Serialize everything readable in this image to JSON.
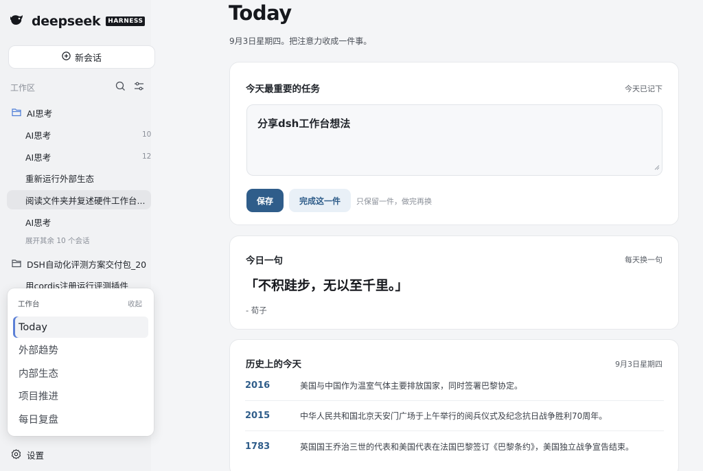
{
  "sidebar": {
    "brand": "deepseek",
    "badge": "HARNESS",
    "new_chat": "新会话",
    "workspace_label": "工作区",
    "folders": [
      {
        "label": "AI思考"
      },
      {
        "label": "DSH自动化评测方案交付包_20"
      }
    ],
    "conversations": [
      {
        "label": "AI思考",
        "count": "10"
      },
      {
        "label": "AI思考",
        "count": "12"
      },
      {
        "label": "重新运行外部生态",
        "count": ""
      },
      {
        "label": "阅读文件夹并复述硬件工作台...",
        "count": ""
      },
      {
        "label": "AI思考",
        "count": ""
      }
    ],
    "expand_more": "展开其余 10 个会话",
    "folder2_item": "用cordis注册运行评测插件",
    "settings": "设置"
  },
  "popover": {
    "title": "工作台",
    "collapse": "收起",
    "items": [
      "Today",
      "外部趋势",
      "内部生态",
      "项目推进",
      "每日复盘"
    ]
  },
  "main": {
    "title": "Today",
    "subtitle": "9月3日星期四。把注意力收成一件事。",
    "task_card": {
      "heading": "今天最重要的任务",
      "meta": "今天已记下",
      "content": "分享dsh工作台想法",
      "save": "保存",
      "done": "完成这一件",
      "hint": "只保留一件，做完再换"
    },
    "quote_card": {
      "heading": "今日一句",
      "meta": "每天换一句",
      "quote": "「不积跬步，无以至千里。」",
      "author": "- 荀子"
    },
    "history_card": {
      "heading": "历史上的今天",
      "meta": "9月3日星期四",
      "rows": [
        {
          "year": "2016",
          "event": "美国与中国作为温室气体主要排放国家，同时签署巴黎协定。"
        },
        {
          "year": "2015",
          "event": "中华人民共和国北京天安门广场于上午举行的阅兵仪式及纪念抗日战争胜利70周年。"
        },
        {
          "year": "1783",
          "event": "英国国王乔治三世的代表和美国代表在法国巴黎签订《巴黎条约》，美国独立战争宣告结束。"
        }
      ]
    }
  }
}
